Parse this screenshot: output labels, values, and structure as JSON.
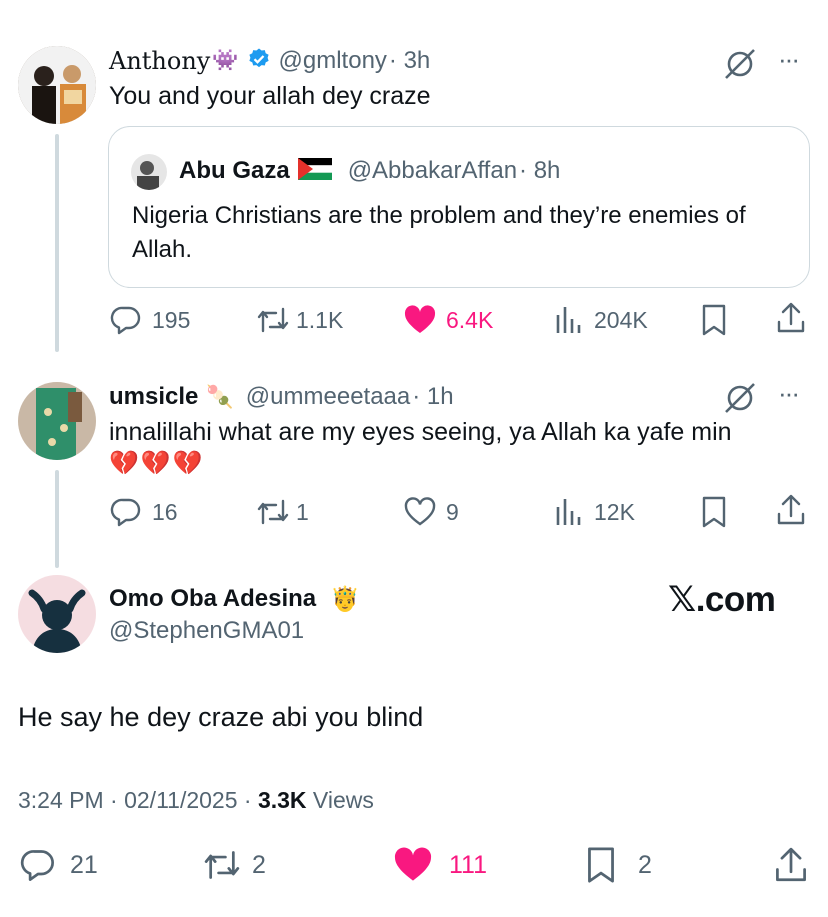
{
  "tweet1": {
    "name": "Anthony",
    "name_emoji": "👾",
    "handle": "@gmltony",
    "time": "· 3h",
    "text": "You and your allah dey craze",
    "more": "···",
    "quote": {
      "name": "Abu Gaza",
      "handle": "@AbbakarAffan",
      "time": "· 8h",
      "text": "Nigeria Christians are the problem and they’re enemies of Allah."
    },
    "actions": {
      "replies": "195",
      "reposts": "1.1K",
      "likes": "6.4K",
      "views": "204K"
    }
  },
  "tweet2": {
    "name": "umsicle",
    "name_emoji": "🍡",
    "handle": "@ummeeetaaa",
    "time": "· 1h",
    "text": "innalillahi what are my eyes seeing, ya Allah ka yafe min",
    "emoji_line": "💔💔💔",
    "more": "···",
    "actions": {
      "replies": "16",
      "reposts": "1",
      "likes": "9",
      "views": "12K"
    }
  },
  "main_tweet": {
    "name": "Omo Oba Adesina",
    "name_emoji": "🤴",
    "handle": "@StephenGMA01",
    "brand": "𝕏.com",
    "text": "He say he dey craze abi you blind",
    "timestamp": "3:24 PM · 02/11/2025 · ",
    "views_count": "3.3K",
    "views_label": " Views",
    "actions": {
      "replies": "21",
      "reposts": "2",
      "likes": "111",
      "bookmarks": "2"
    }
  },
  "colors": {
    "like": "#f91880",
    "muted": "#536471",
    "verified": "#1d9bf0",
    "thread": "#cfd9de"
  }
}
